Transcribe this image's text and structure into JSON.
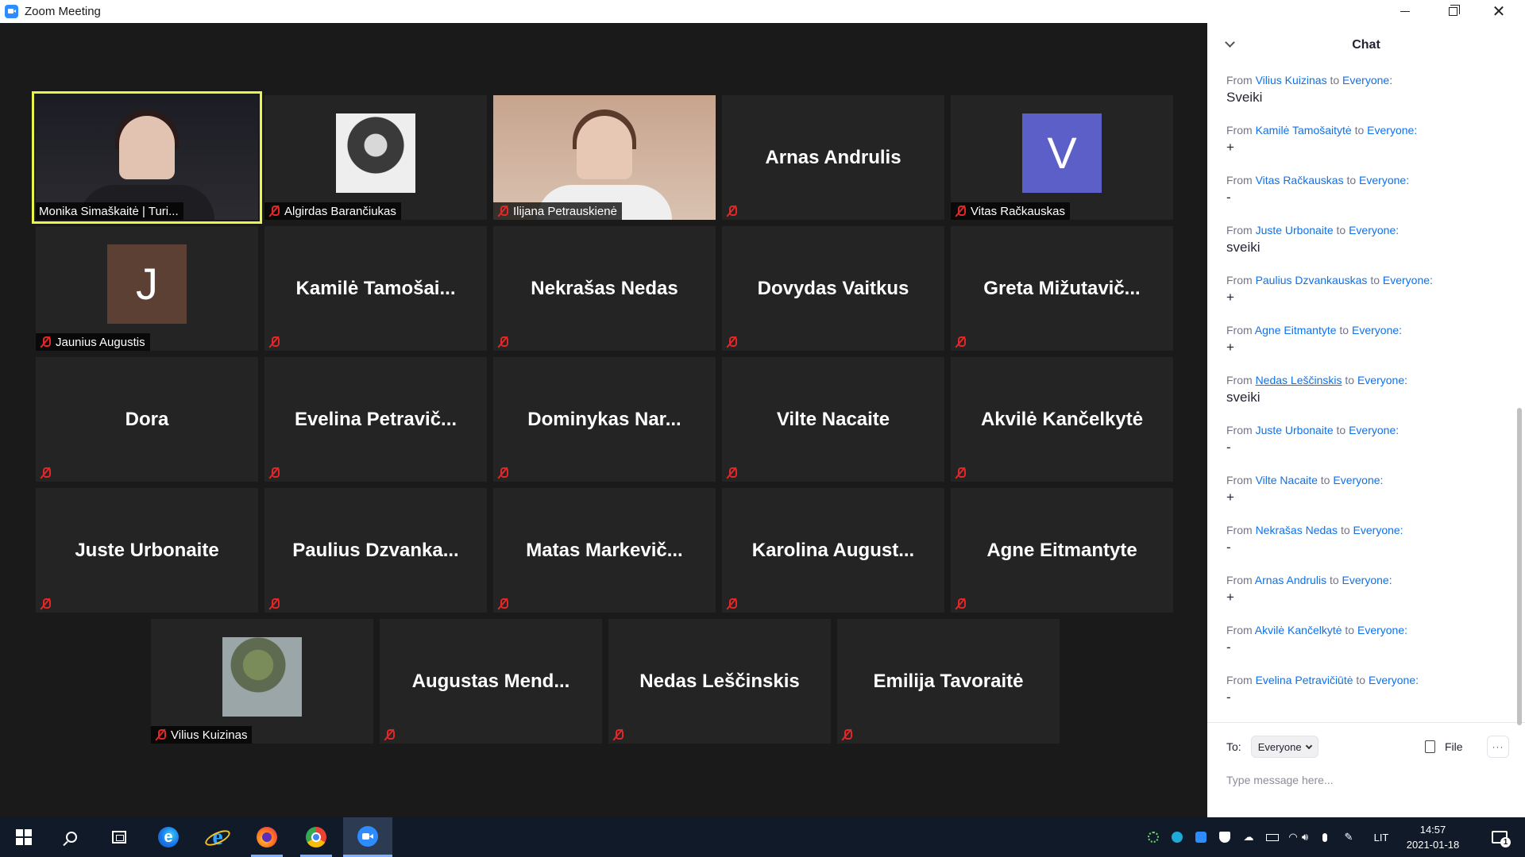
{
  "window": {
    "title": "Zoom Meeting"
  },
  "participants": [
    {
      "name": "Monika Simaškaitė | Turi...",
      "label": "Monika Simaškaitė | Turi...",
      "video": "webcam",
      "muted": false,
      "speaking": true
    },
    {
      "name": "Algirdas Barančiukas",
      "label": "Algirdas Barančiukas",
      "video": "photo-bw",
      "muted": true
    },
    {
      "name": "Ilijana Petrauskienė",
      "label": "Ilijana Petrauskienė",
      "video": "webcam",
      "muted": true
    },
    {
      "name": "Arnas Andrulis",
      "label": "",
      "video": "none",
      "muted": true
    },
    {
      "name": "Vitas Račkauskas",
      "label": "Vitas Račkauskas",
      "video": "avatar",
      "avatar_letter": "V",
      "avatar_color": "#5b5fc7",
      "muted": true
    },
    {
      "name": "Jaunius Augustis",
      "label": "Jaunius Augustis",
      "video": "avatar",
      "avatar_letter": "J",
      "avatar_color": "#5c4033",
      "muted": true
    },
    {
      "name": "Kamilė  Tamošai...",
      "label": "",
      "video": "none",
      "muted": true
    },
    {
      "name": "Nekrašas Nedas",
      "label": "",
      "video": "none",
      "muted": true
    },
    {
      "name": "Dovydas Vaitkus",
      "label": "",
      "video": "none",
      "muted": true
    },
    {
      "name": "Greta  Mižutavič...",
      "label": "",
      "video": "none",
      "muted": true
    },
    {
      "name": "Dora",
      "label": "",
      "video": "none",
      "muted": true
    },
    {
      "name": "Evelina  Petravič...",
      "label": "",
      "video": "none",
      "muted": true
    },
    {
      "name": "Dominykas  Nar...",
      "label": "",
      "video": "none",
      "muted": true
    },
    {
      "name": "Vilte Nacaite",
      "label": "",
      "video": "none",
      "muted": true
    },
    {
      "name": "Akvilė Kančelkytė",
      "label": "",
      "video": "none",
      "muted": true
    },
    {
      "name": "Juste Urbonaite",
      "label": "",
      "video": "none",
      "muted": true
    },
    {
      "name": "Paulius  Dzvanka...",
      "label": "",
      "video": "none",
      "muted": true
    },
    {
      "name": "Matas  Markevič...",
      "label": "",
      "video": "none",
      "muted": true
    },
    {
      "name": "Karolina  August...",
      "label": "",
      "video": "none",
      "muted": true
    },
    {
      "name": "Agne Eitmantyte",
      "label": "",
      "video": "none",
      "muted": true
    },
    {
      "name": "Vilius Kuizinas",
      "label": "Vilius Kuizinas",
      "video": "photo-yoda",
      "muted": true
    },
    {
      "name": "Augustas  Mend...",
      "label": "",
      "video": "none",
      "muted": true
    },
    {
      "name": "Nedas Leščinskis",
      "label": "",
      "video": "none",
      "muted": true
    },
    {
      "name": "Emilija Tavoraitė",
      "label": "",
      "video": "none",
      "muted": true
    }
  ],
  "chat": {
    "title": "Chat",
    "from_word": "From",
    "to_word": "to",
    "recipient": "Everyone:",
    "messages": [
      {
        "sender": "Vilius Kuizinas",
        "text": "Sveiki"
      },
      {
        "sender": "Kamilė Tamošaitytė",
        "text": "+"
      },
      {
        "sender": "Vitas Račkauskas",
        "text": "-"
      },
      {
        "sender": "Juste Urbonaite",
        "text": "sveiki"
      },
      {
        "sender": "Paulius Dzvankauskas",
        "text": "+"
      },
      {
        "sender": "Agne Eitmantyte",
        "text": "+"
      },
      {
        "sender": "Nedas Leščinskis",
        "text": "sveiki",
        "link": true
      },
      {
        "sender": "Juste Urbonaite",
        "text": "-"
      },
      {
        "sender": "Vilte Nacaite",
        "text": "+"
      },
      {
        "sender": "Nekrašas Nedas",
        "text": "-"
      },
      {
        "sender": "Arnas Andrulis",
        "text": "+"
      },
      {
        "sender": "Akvilė Kančelkytė",
        "text": "-"
      },
      {
        "sender": "Evelina Petravičiūtė",
        "text": "-"
      }
    ],
    "to_label": "To:",
    "to_value": "Everyone",
    "file_label": "File",
    "more_label": "···",
    "input_placeholder": "Type message here..."
  },
  "taskbar": {
    "apps": [
      "windows-start",
      "search",
      "task-view",
      "edge",
      "internet-explorer",
      "firefox",
      "chrome",
      "zoom"
    ],
    "active_app": "zoom",
    "language": "LIT",
    "time": "14:57",
    "date": "2021-01-18",
    "notification_count": "1"
  },
  "colors": {
    "speaking_border": "#e8f54b",
    "muted_icon": "#e02828",
    "chat_link": "#0e71eb"
  }
}
